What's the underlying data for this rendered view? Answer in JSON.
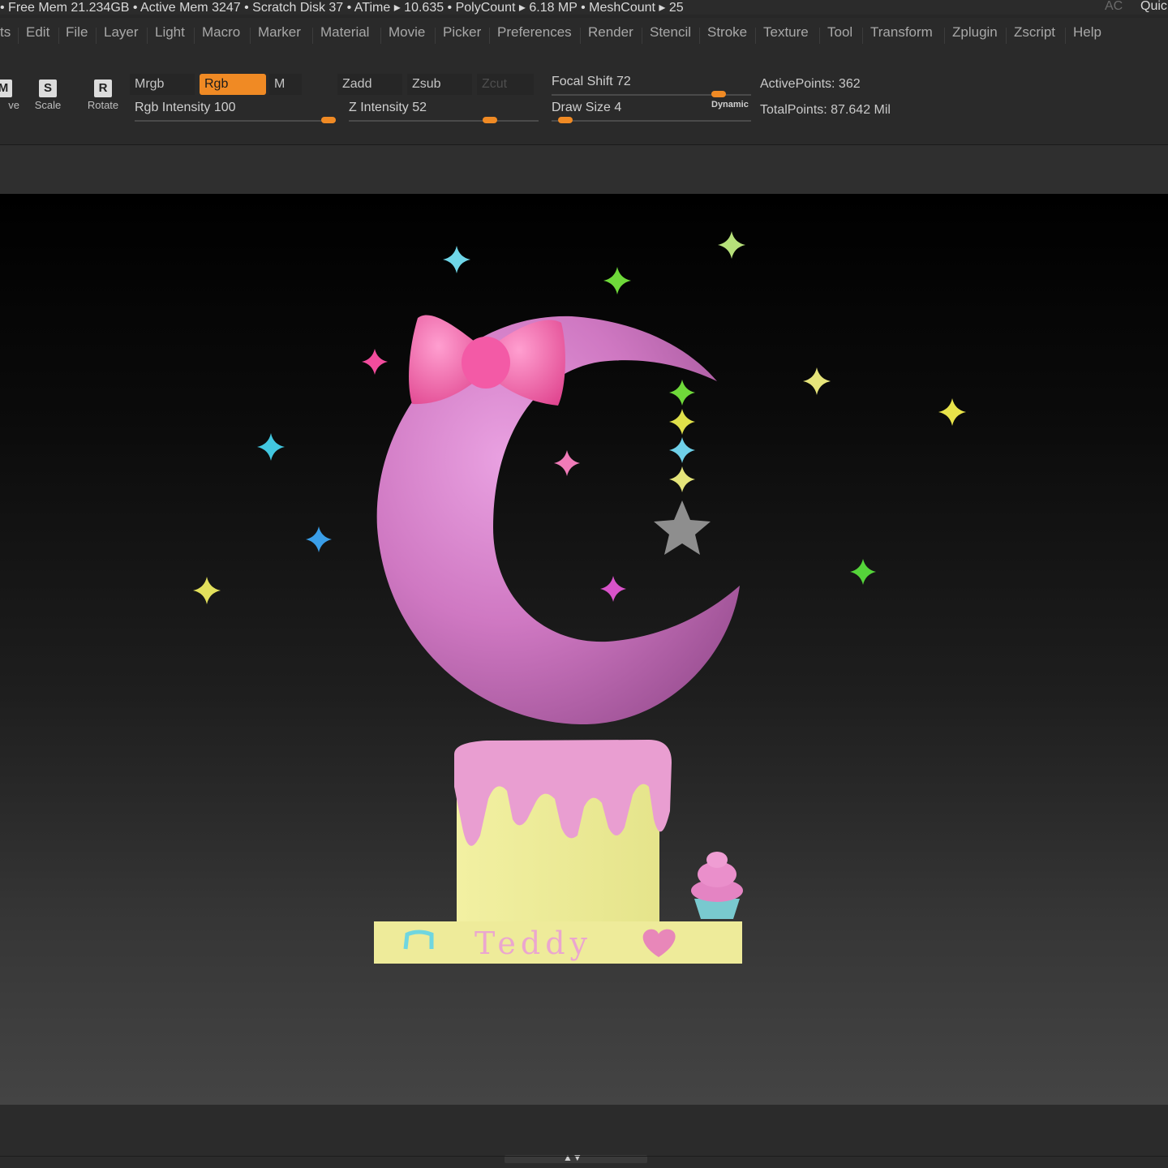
{
  "status": {
    "text": "• Free Mem 21.234GB • Active Mem 3247 • Scratch Disk 37 •  ATime ▸ 10.635 • PolyCount ▸ 6.18 MP  • MeshCount ▸ 25",
    "ac": "AC",
    "quick": "Quic"
  },
  "menu": [
    {
      "label": "ts"
    },
    {
      "label": "Edit"
    },
    {
      "label": "File"
    },
    {
      "label": "Layer"
    },
    {
      "label": "Light"
    },
    {
      "label": "Macro"
    },
    {
      "label": "Marker"
    },
    {
      "label": "Material"
    },
    {
      "label": "Movie"
    },
    {
      "label": "Picker"
    },
    {
      "label": "Preferences"
    },
    {
      "label": "Render"
    },
    {
      "label": "Stencil"
    },
    {
      "label": "Stroke"
    },
    {
      "label": "Texture"
    },
    {
      "label": "Tool"
    },
    {
      "label": "Transform"
    },
    {
      "label": "Zplugin"
    },
    {
      "label": "Zscript"
    },
    {
      "label": "Help"
    }
  ],
  "tools": {
    "move": {
      "glyph": "M",
      "label": "ve"
    },
    "scale": {
      "glyph": "S",
      "label": "Scale"
    },
    "rotate": {
      "glyph": "R",
      "label": "Rotate"
    }
  },
  "color_mode": {
    "mrgb": "Mrgb",
    "rgb": "Rgb",
    "m": "M",
    "active": "rgb"
  },
  "depth_mode": {
    "zadd": "Zadd",
    "zsub": "Zsub",
    "zcut": "Zcut"
  },
  "rgb_intensity": {
    "label": "Rgb Intensity 100",
    "value": 100,
    "min": 0,
    "max": 100
  },
  "z_intensity": {
    "label": "Z Intensity 52",
    "value": 52,
    "min": 0,
    "max": 100
  },
  "focal_shift": {
    "label": "Focal Shift 72",
    "value": 72,
    "min": -100,
    "max": 100
  },
  "draw_size": {
    "label": "Draw Size 4",
    "value": 4,
    "min": 1,
    "max": 1000
  },
  "dynamic_label": "Dynamic",
  "active_points": "ActivePoints: 362",
  "total_points": "TotalPoints: 87.642 Mil",
  "model_text": "Teddy",
  "accent_color": "#f08a24"
}
